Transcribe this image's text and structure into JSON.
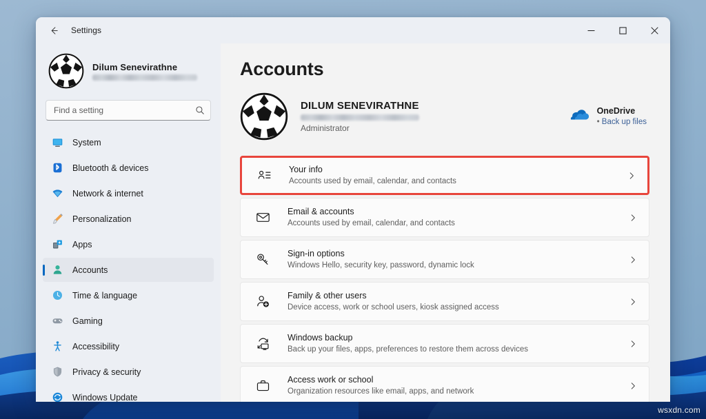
{
  "window": {
    "app_title": "Settings",
    "back_icon": "back-arrow-icon",
    "controls": {
      "minimize": "minimize-icon",
      "maximize": "maximize-icon",
      "close": "close-icon"
    }
  },
  "sidebar": {
    "profile": {
      "name": "Dilum Senevirathne",
      "email_redacted": "",
      "avatar": "soccer-ball-avatar"
    },
    "search": {
      "placeholder": "Find a setting",
      "value": "",
      "icon": "search-icon"
    },
    "items": [
      {
        "label": "System",
        "icon": "system-icon",
        "active": false
      },
      {
        "label": "Bluetooth & devices",
        "icon": "bluetooth-icon",
        "active": false
      },
      {
        "label": "Network & internet",
        "icon": "wifi-icon",
        "active": false
      },
      {
        "label": "Personalization",
        "icon": "paintbrush-icon",
        "active": false
      },
      {
        "label": "Apps",
        "icon": "apps-icon",
        "active": false
      },
      {
        "label": "Accounts",
        "icon": "accounts-icon",
        "active": true
      },
      {
        "label": "Time & language",
        "icon": "clock-globe-icon",
        "active": false
      },
      {
        "label": "Gaming",
        "icon": "gamepad-icon",
        "active": false
      },
      {
        "label": "Accessibility",
        "icon": "accessibility-icon",
        "active": false
      },
      {
        "label": "Privacy & security",
        "icon": "shield-icon",
        "active": false
      },
      {
        "label": "Windows Update",
        "icon": "update-icon",
        "active": false
      }
    ]
  },
  "main": {
    "page_title": "Accounts",
    "account": {
      "avatar": "soccer-ball-avatar",
      "name": "DILUM SENEVIRATHNE",
      "email_redacted": "",
      "role": "Administrator"
    },
    "onedrive": {
      "icon": "onedrive-cloud-icon",
      "title": "OneDrive",
      "link": "Back up files",
      "bullet": "•"
    },
    "cards": [
      {
        "title": "Your info",
        "subtitle": "Accounts used by email, calendar, and contacts",
        "icon": "contact-card-icon",
        "highlighted": true
      },
      {
        "title": "Email & accounts",
        "subtitle": "Accounts used by email, calendar, and contacts",
        "icon": "envelope-icon",
        "highlighted": false
      },
      {
        "title": "Sign-in options",
        "subtitle": "Windows Hello, security key, password, dynamic lock",
        "icon": "key-icon",
        "highlighted": false
      },
      {
        "title": "Family & other users",
        "subtitle": "Device access, work or school users, kiosk assigned access",
        "icon": "add-person-icon",
        "highlighted": false
      },
      {
        "title": "Windows backup",
        "subtitle": "Back up your files, apps, preferences to restore them across devices",
        "icon": "backup-icon",
        "highlighted": false
      },
      {
        "title": "Access work or school",
        "subtitle": "Organization resources like email, apps, and network",
        "icon": "briefcase-icon",
        "highlighted": false
      }
    ],
    "chevron_icon": "chevron-right-icon"
  },
  "desktop": {
    "watermark": "wsxdn.com"
  },
  "colors": {
    "accent": "#0067c0",
    "highlight_border": "#e8453c",
    "onedrive_blue": "#0f6cbd",
    "link_blue": "#3a5f96",
    "wallpaper_blue": "#8fb0cc"
  }
}
